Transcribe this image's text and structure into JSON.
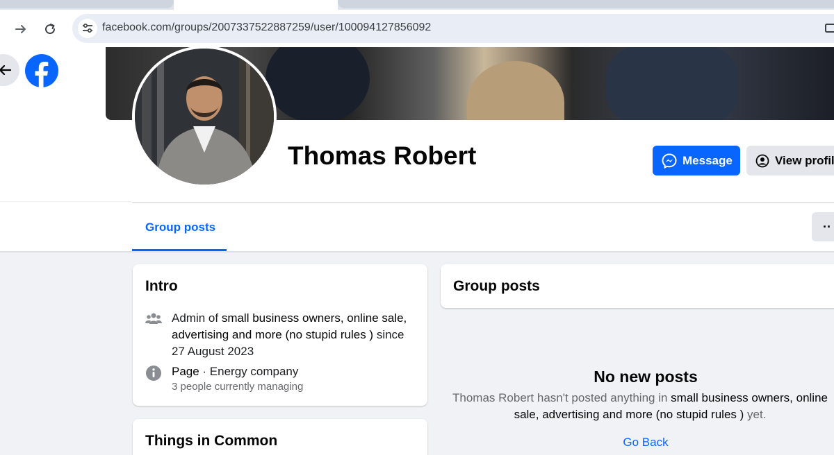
{
  "browser": {
    "url": "facebook.com/groups/2007337522887259/user/100094127856092"
  },
  "profile": {
    "name": "Thomas Robert",
    "message_label": "Message",
    "view_profile_label": "View profil"
  },
  "tabs": {
    "group_posts_label": "Group posts",
    "more_label": "··"
  },
  "intro": {
    "title": "Intro",
    "admin_prefix": "Admin of ",
    "group_name": "small business owners, online sale, advertising and more (no stupid rules )",
    "since_text": " since 27 August 2023",
    "page_label": "Page",
    "page_category": " · Energy company",
    "managing_text": "3 people currently managing"
  },
  "common": {
    "title": "Things in Common"
  },
  "group_posts_card": {
    "title": "Group posts",
    "empty_title": "No new posts",
    "empty_prefix": "Thomas Robert hasn't posted anything in ",
    "empty_group": "small business owners, online sale, advertising and more (no stupid rules )",
    "empty_suffix": " yet.",
    "go_back_label": "Go Back"
  },
  "colors": {
    "accent": "#0866ff",
    "background": "#f0f2f5"
  },
  "icons": [
    "back-arrow-icon",
    "forward-arrow-icon",
    "reload-icon",
    "site-settings-icon",
    "facebook-logo",
    "messenger-icon",
    "user-circle-icon",
    "group-icon",
    "info-icon"
  ]
}
